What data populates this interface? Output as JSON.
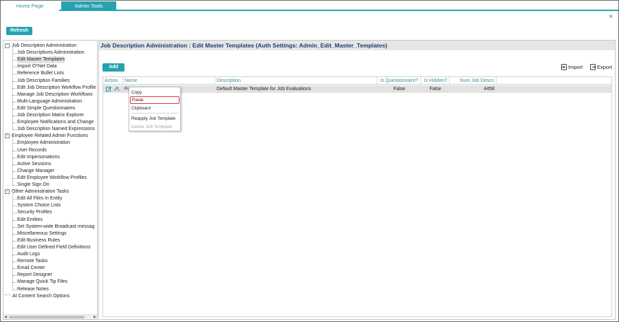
{
  "tabs": [
    {
      "label": "Home Page",
      "active": false
    },
    {
      "label": "Admin Tools",
      "active": true
    }
  ],
  "actions": {
    "refresh_label": "Refresh",
    "close_label": "×"
  },
  "tree": {
    "groups": [
      {
        "label": "Job Description Administration",
        "expander": "⊟",
        "items": [
          "Job Descriptions Administration",
          "Edit Master Templates",
          "Import O*Net Data",
          "Reference Bullet Lists",
          "Job Description Families",
          "Edit Job Description Workflow Profile",
          "Manage Job Description Workflows",
          "Multi-Language Administration",
          "Edit Simple Questionnaires",
          "Job Description Matrix Explorer",
          "Employee Notifications and Change",
          "Job Description Named Expressions"
        ],
        "selected_index": 1
      },
      {
        "label": "Employee Related Admin Functions",
        "expander": "⊟",
        "items": [
          "Employee Administration",
          "User Records",
          "Edit Impersonations",
          "Active Sessions",
          "Change Manager",
          "Edit Employee Workflow Profiles",
          "Single Sign On"
        ]
      },
      {
        "label": "Other Administration Tasks",
        "expander": "⊟",
        "items": [
          "Edit All Files In Entity",
          "System Choice Lists",
          "Security Profiles",
          "Edit Entities",
          "Set System-wide Broadcast messag",
          "Miscellaneous Settings",
          "Edit Business Rules",
          "Edit User Defined Field Definitions",
          "Audit Logs",
          "Remote Tasks",
          "Email Center",
          "Report Designer",
          "Manage Quick Tip Files",
          "Release Notes"
        ]
      },
      {
        "label": "AI Content Search Options",
        "expander": "",
        "items": []
      }
    ]
  },
  "main": {
    "title": "Job Description Administration : Edit Master Templates (Auth Settings: Admin_Edit_Master_Templates)",
    "add_label": "Add",
    "import_label": "Import",
    "export_label": "Export"
  },
  "grid": {
    "columns": [
      "Action",
      "Name",
      "Description",
      "Is Questionnaire?",
      "Is Hidden?",
      "Num Job Descs"
    ],
    "rows": [
      {
        "name": "Fir",
        "description": "Default Master Template for Job Evaluations",
        "is_questionnaire": "False",
        "is_hidden": "False",
        "num_job_descs": "4458"
      }
    ]
  },
  "context_menu": {
    "items": [
      {
        "label": "Copy",
        "highlighted": false,
        "disabled": false
      },
      {
        "label": "Paste",
        "highlighted": true,
        "disabled": false
      },
      {
        "label": "Clipboard",
        "highlighted": false,
        "disabled": false
      },
      {
        "label": "Reapply Job Template",
        "highlighted": false,
        "disabled": false
      },
      {
        "label": "Delete Job Template",
        "highlighted": false,
        "disabled": true
      }
    ]
  },
  "colors": {
    "accent": "#26a3b0",
    "title_text": "#1e3a6e",
    "highlight_border": "#d9343b"
  },
  "icons": [
    "close-icon",
    "import-icon",
    "export-icon",
    "edit-icon",
    "copy-icon"
  ]
}
